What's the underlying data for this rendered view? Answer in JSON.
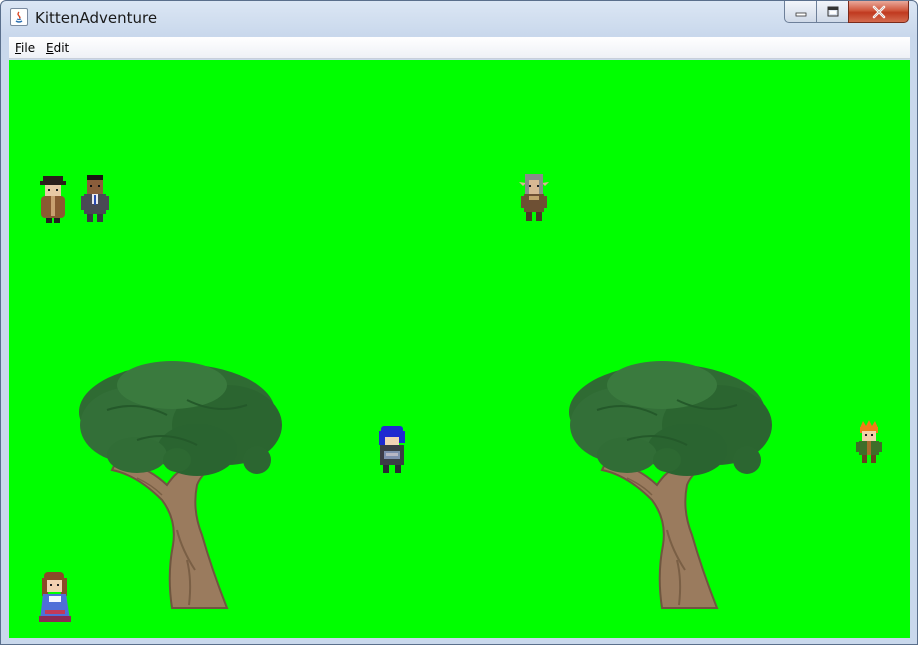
{
  "window": {
    "title": "KittenAdventure",
    "app_icon": "java-icon",
    "controls": [
      "minimize-icon",
      "maximize-icon",
      "close-icon"
    ]
  },
  "menubar": {
    "items": [
      {
        "label": "File",
        "mnemonic": "F",
        "rest": "ile"
      },
      {
        "label": "Edit",
        "mnemonic": "E",
        "rest": "dit"
      }
    ]
  },
  "scene": {
    "background_color": "#00ff00",
    "trees": [
      "tree-left",
      "tree-right"
    ],
    "characters": [
      "npc-hat-man",
      "npc-suit-man",
      "npc-elf-gray",
      "player-blue-hair",
      "npc-orange-hair",
      "npc-brown-hair-girl"
    ]
  }
}
